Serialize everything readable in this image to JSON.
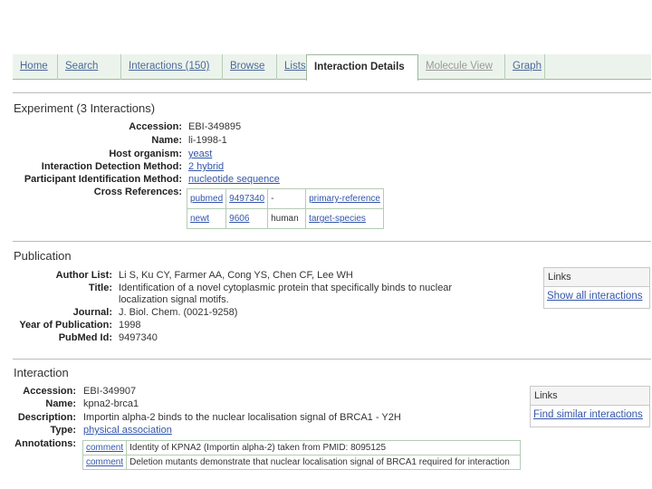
{
  "tabs": [
    "Home",
    "Search",
    "Interactions (150)",
    "Browse",
    "Lists",
    "Interaction Details",
    "Molecule View",
    "Graph"
  ],
  "experiment": {
    "title": "Experiment (3 Interactions)",
    "fields": [
      {
        "label": "Accession:",
        "value": "EBI-349895"
      },
      {
        "label": "Name:",
        "value": "li-1998-1"
      },
      {
        "label": "Host organism:",
        "value": "yeast"
      },
      {
        "label": "Interaction Detection Method:",
        "value": "2 hybrid"
      },
      {
        "label": "Participant Identification Method:",
        "value": "nucleotide sequence"
      },
      {
        "label": "Cross References:",
        "value": ""
      }
    ],
    "xrefs": [
      [
        "pubmed",
        "9497340",
        "-",
        "primary-reference"
      ],
      [
        "newt",
        "9606",
        "human",
        "target-species"
      ]
    ]
  },
  "publication": {
    "title": "Publication",
    "fields": [
      {
        "label": "Author List:",
        "value": "Li S, Ku CY, Farmer AA, Cong YS, Chen CF, Lee WH"
      },
      {
        "label": "Title:",
        "value": "Identification of a novel cytoplasmic protein that specifically binds to nuclear"
      },
      {
        "label": "",
        "value": "localization signal motifs."
      },
      {
        "label": "Journal:",
        "value": "J. Biol. Chem. (0021-9258)"
      },
      {
        "label": "Year of Publication:",
        "value": "1998"
      },
      {
        "label": "PubMed Id:",
        "value": "9497340"
      }
    ],
    "links_title": "Links",
    "links_item": "Show all interactions"
  },
  "interaction": {
    "title": "Interaction",
    "fields": [
      {
        "label": "Accession:",
        "value": "EBI-349907"
      },
      {
        "label": "Name:",
        "value": "kpna2-brca1"
      },
      {
        "label": "Description:",
        "value": "Importin alpha-2 binds to the nuclear localisation signal of BRCA1 - Y2H"
      },
      {
        "label": "Type:",
        "value": "physical association"
      },
      {
        "label": "Annotations:",
        "value": ""
      }
    ],
    "annotations": [
      [
        "comment",
        "Identity of KPNA2 (Importin alpha-2) taken from PMID: 8095125"
      ],
      [
        "comment",
        "Deletion mutants demonstrate that nuclear localisation signal of BRCA1 required for interaction"
      ]
    ],
    "links_title": "Links",
    "links_item": "Find similar interactions"
  }
}
